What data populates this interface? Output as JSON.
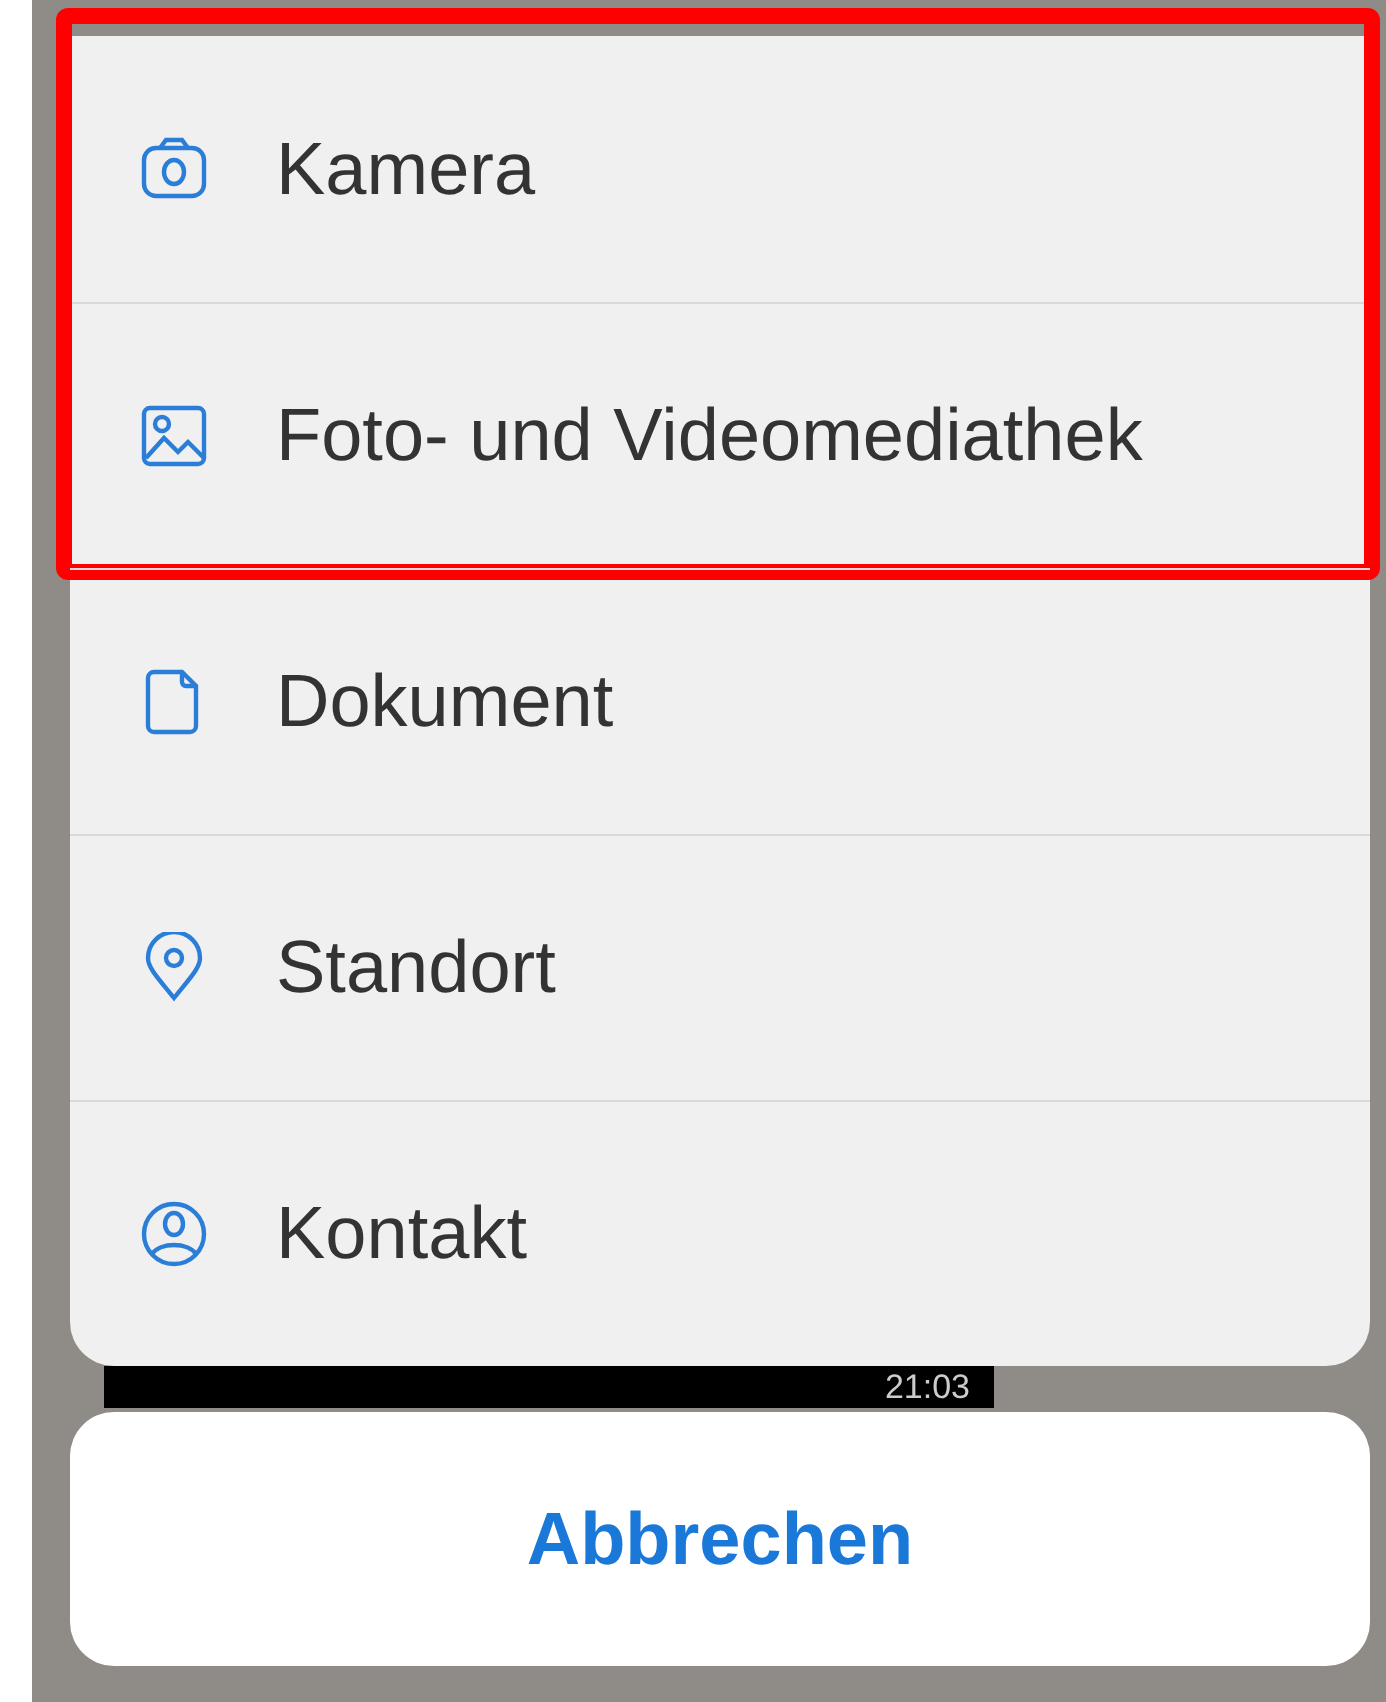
{
  "action_sheet": {
    "items": [
      {
        "kind": "camera",
        "label": "Kamera",
        "highlighted": true
      },
      {
        "kind": "photo",
        "label": "Foto- und Videomediathek",
        "highlighted": true
      },
      {
        "kind": "document",
        "label": "Dokument",
        "highlighted": false
      },
      {
        "kind": "location",
        "label": "Standort",
        "highlighted": false
      },
      {
        "kind": "contact",
        "label": "Kontakt",
        "highlighted": false
      }
    ]
  },
  "message_behind": {
    "time": "21:03"
  },
  "cancel_button": {
    "label": "Abbrechen"
  }
}
